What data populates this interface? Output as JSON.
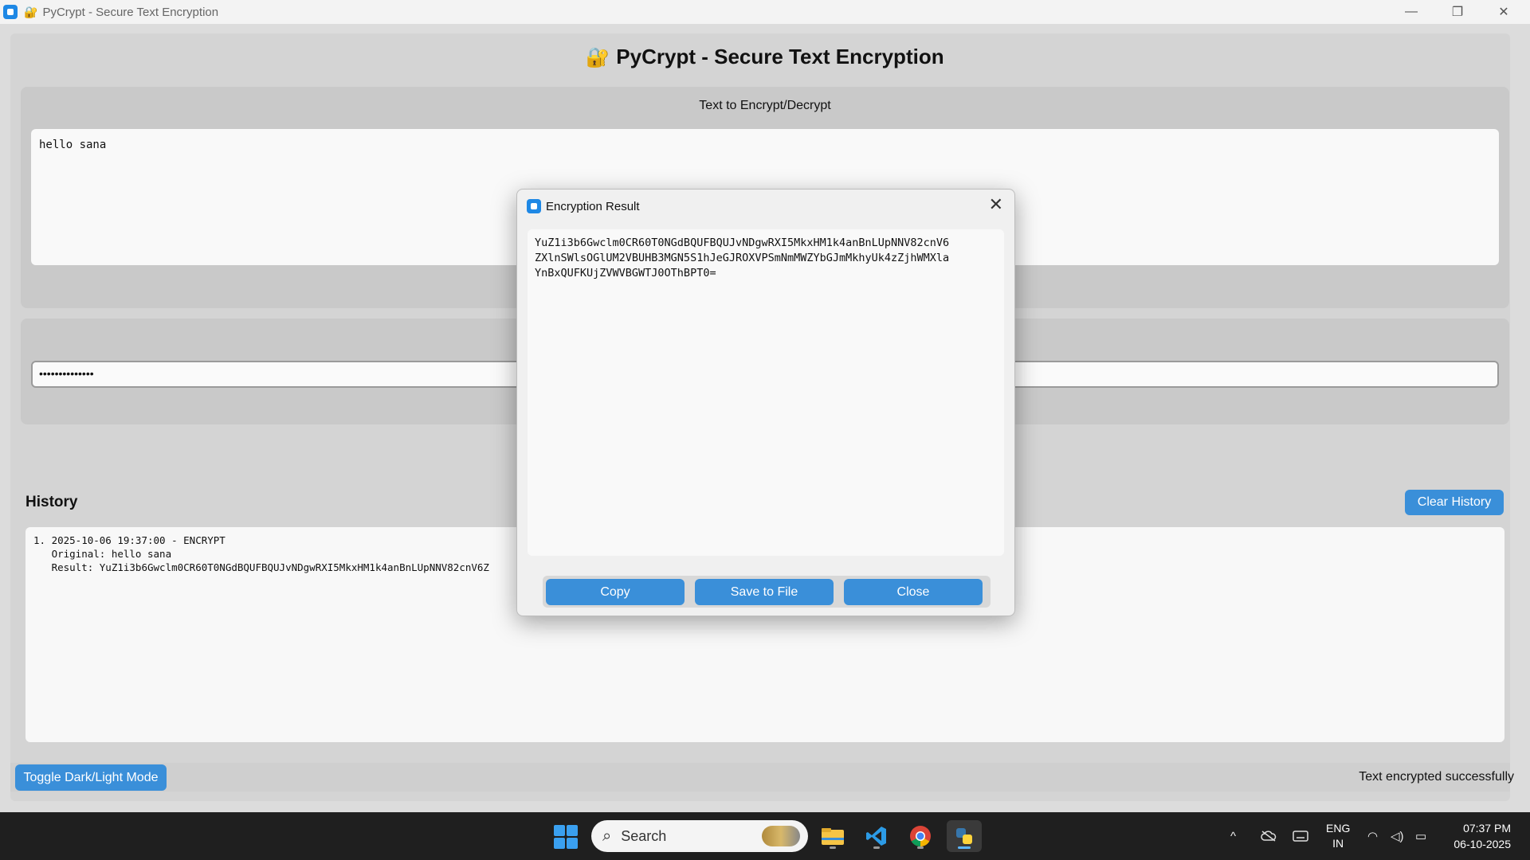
{
  "window": {
    "title": "PyCrypt - Secure Text Encryption",
    "lock_glyph": "🔐",
    "minimize": "—",
    "maximize": "❐",
    "close": "✕"
  },
  "app": {
    "heading": "PyCrypt - Secure Text Encryption",
    "heading_icon": "🔐",
    "input_label": "Text to Encrypt/Decrypt",
    "input_text": "hello sana",
    "password_value": "••••••••••••••",
    "history_title": "History",
    "clear_history_label": "Clear History",
    "history_entries": "1. 2025-10-06 19:37:00 - ENCRYPT\n   Original: hello sana\n   Result: YuZ1i3b6Gwclm0CR60T0NGdBQUFBQUJvNDgwRXI5MkxHM1k4anBnLUpNNV82cnV6Z",
    "toggle_mode_label": "Toggle Dark/Light Mode",
    "status_text": "Text encrypted successfully"
  },
  "dialog": {
    "title": "Encryption Result",
    "close_glyph": "✕",
    "result_text": "YuZ1i3b6Gwclm0CR60T0NGdBQUFBQUJvNDgwRXI5MkxHM1k4anBnLUpNNV82cnV6\nZXlnSWlsOGlUM2VBUHB3MGN5S1hJeGJROXVPSmNmMWZYbGJmMkhyUk4zZjhWMXla\nYnBxQUFKUjZVWVBGWTJ0OThBPT0=",
    "copy_label": "Copy",
    "save_label": "Save to File",
    "close_label": "Close"
  },
  "taskbar": {
    "search_placeholder": "Search",
    "search_icon": "⌕",
    "language_top": "ENG",
    "language_bottom": "IN",
    "time": "07:37 PM",
    "date": "06-10-2025",
    "tray_chevron": "^",
    "tray_wifi": "◠",
    "tray_volume": "◁)",
    "tray_battery": "▭"
  },
  "colors": {
    "accent_button": "#3a8fd9",
    "taskbar_bg": "#1f1f1f"
  }
}
